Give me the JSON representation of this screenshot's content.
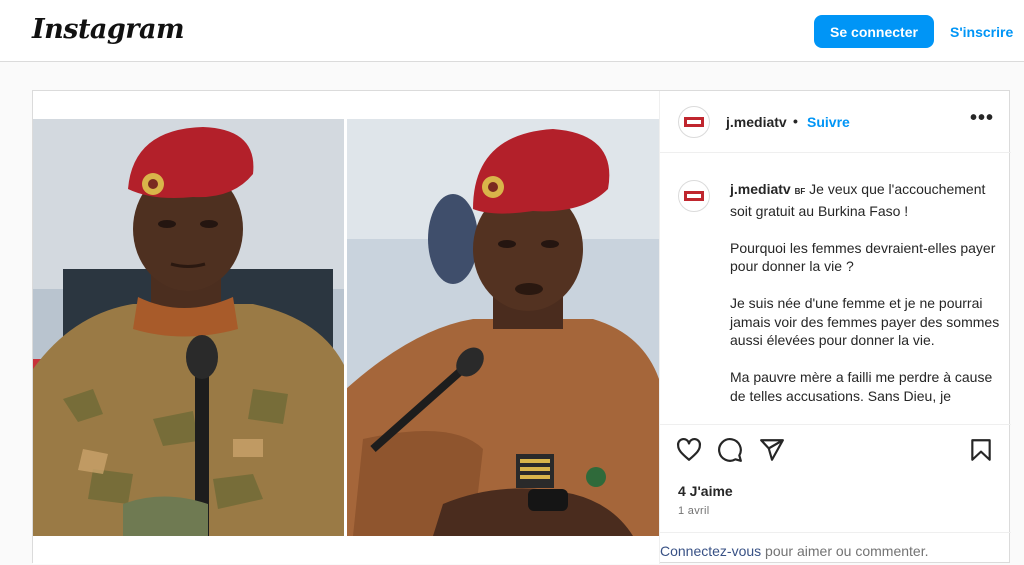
{
  "header": {
    "logo": "Instagram",
    "login_button": "Se connecter",
    "signup_link": "S'inscrire"
  },
  "post": {
    "username": "j.mediatv",
    "separator": "•",
    "follow_label": "Suivre",
    "more_label": "•••",
    "caption_user": "j.mediatv",
    "caption_flag": "BF",
    "caption_lines": [
      "Je veux que l'accouchement soit gratuit au Burkina Faso !",
      "Pourquoi les femmes devraient-elles payer pour donner la vie ?",
      "Je suis née d'une femme et je ne pourrai jamais voir des femmes payer des sommes aussi élevées pour donner la vie.",
      "Ma pauvre mère a failli me perdre à cause de telles accusations. Sans Dieu, je"
    ],
    "likes": "4 J'aime",
    "date": "1 avril",
    "login_prompt_link": "Connectez-vous",
    "login_prompt_rest": " pour aimer ou commenter."
  },
  "colors": {
    "accent": "#0095f6",
    "beret": "#b3202a",
    "uniform_camo": "#9a7a45",
    "uniform_plain": "#a5663a"
  },
  "icons": [
    "heart-icon",
    "comment-icon",
    "share-icon",
    "bookmark-icon",
    "more-icon"
  ]
}
